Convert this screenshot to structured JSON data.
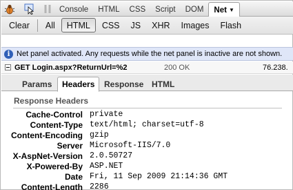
{
  "toolbar": {
    "icons": [
      "firebug-bug-icon",
      "inspect-cursor-icon",
      "pause-icon"
    ],
    "tabs": [
      {
        "label": "Console",
        "active": false
      },
      {
        "label": "HTML",
        "active": false
      },
      {
        "label": "CSS",
        "active": false
      },
      {
        "label": "Script",
        "active": false
      },
      {
        "label": "DOM",
        "active": false
      },
      {
        "label": "Net",
        "active": true
      }
    ],
    "dropdown_icon": "chevron-down-icon"
  },
  "filterbar": {
    "clear_label": "Clear",
    "filters": [
      {
        "label": "All",
        "active": false
      },
      {
        "label": "HTML",
        "active": true
      },
      {
        "label": "CSS",
        "active": false
      },
      {
        "label": "JS",
        "active": false
      },
      {
        "label": "XHR",
        "active": false
      },
      {
        "label": "Images",
        "active": false
      },
      {
        "label": "Flash",
        "active": false
      }
    ]
  },
  "info": {
    "icon": "info-icon",
    "text": "Net panel activated. Any requests while the net panel is inactive are not shown."
  },
  "request": {
    "method_url": "GET Login.aspx?ReturnUrl=%2",
    "status": "200 OK",
    "ip": "76.238."
  },
  "subtabs": [
    {
      "label": "Params",
      "active": false
    },
    {
      "label": "Headers",
      "active": true
    },
    {
      "label": "Response",
      "active": false
    },
    {
      "label": "HTML",
      "active": false
    }
  ],
  "response_headers": {
    "title": "Response Headers",
    "rows": [
      {
        "name": "Cache-Control",
        "value": "private"
      },
      {
        "name": "Content-Type",
        "value": "text/html; charset=utf-8"
      },
      {
        "name": "Content-Encoding",
        "value": "gzip"
      },
      {
        "name": "Server",
        "value": "Microsoft-IIS/7.0"
      },
      {
        "name": "X-AspNet-Version",
        "value": "2.0.50727"
      },
      {
        "name": "X-Powered-By",
        "value": "ASP.NET"
      },
      {
        "name": "Date",
        "value": "Fri, 11 Sep 2009 21:14:36 GMT"
      },
      {
        "name": "Content-Length",
        "value": "2286"
      }
    ]
  }
}
